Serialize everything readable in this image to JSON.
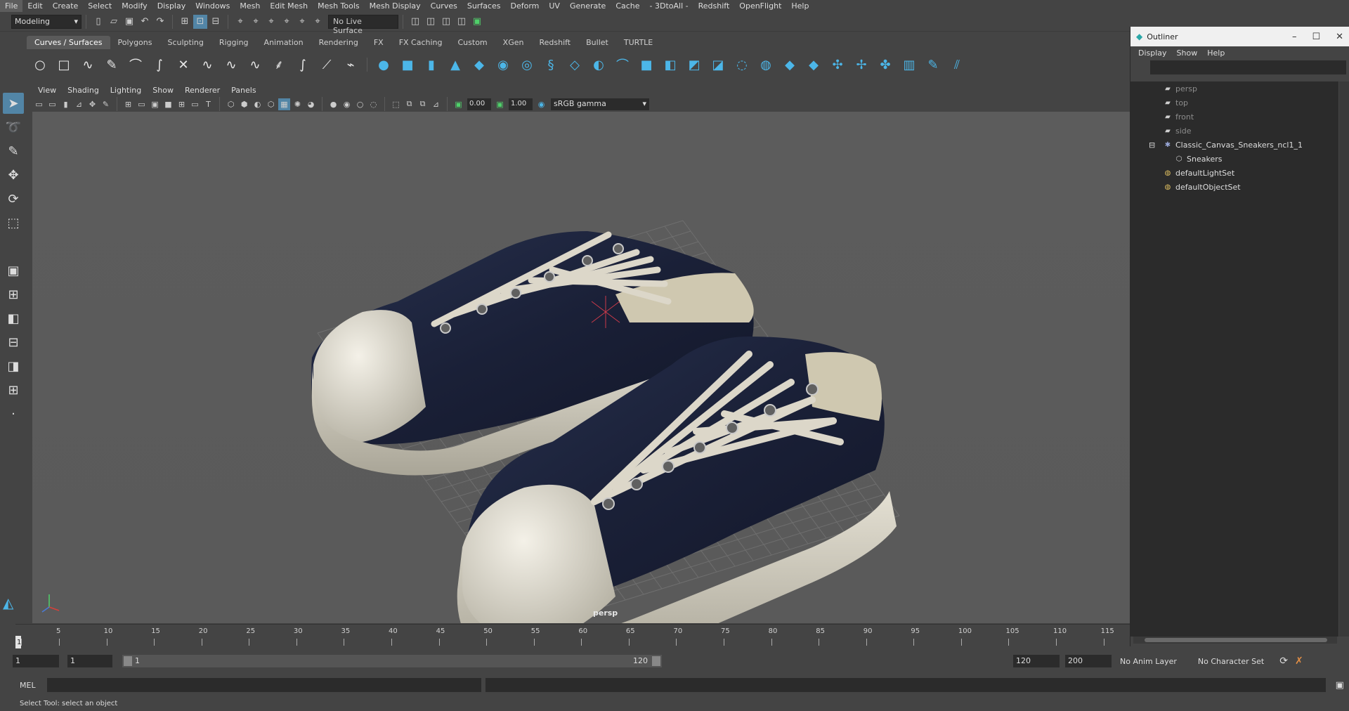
{
  "menu": [
    "File",
    "Edit",
    "Create",
    "Select",
    "Modify",
    "Display",
    "Windows",
    "Mesh",
    "Edit Mesh",
    "Mesh Tools",
    "Mesh Display",
    "Curves",
    "Surfaces",
    "Deform",
    "UV",
    "Generate",
    "Cache",
    "- 3DtoAll -",
    "Redshift",
    "OpenFlight",
    "Help"
  ],
  "status_line": {
    "mode": "Modeling",
    "live_surface": "No Live Surface"
  },
  "shelf_tabs": [
    "Curves / Surfaces",
    "Polygons",
    "Sculpting",
    "Rigging",
    "Animation",
    "Rendering",
    "FX",
    "FX Caching",
    "Custom",
    "XGen",
    "Redshift",
    "Bullet",
    "TURTLE"
  ],
  "shelf_active": "Curves / Surfaces",
  "panel_menu": [
    "View",
    "Shading",
    "Lighting",
    "Show",
    "Renderer",
    "Panels"
  ],
  "panel_toolbar": {
    "exposure": "0.00",
    "gamma": "1.00",
    "color_space": "sRGB gamma"
  },
  "viewport": {
    "camera_label": "persp"
  },
  "timeline": {
    "ticks": [
      "1",
      "5",
      "10",
      "15",
      "20",
      "25",
      "30",
      "35",
      "40",
      "45",
      "50",
      "55",
      "60",
      "65",
      "70",
      "75",
      "80",
      "85",
      "90",
      "95",
      "100",
      "105",
      "110",
      "115"
    ],
    "current_frame": "1"
  },
  "range": {
    "start": "1",
    "playback_start": "1",
    "slider_start": "1",
    "slider_end": "120",
    "playback_end": "120",
    "end": "200",
    "anim_layer": "No Anim Layer",
    "character_set": "No Character Set"
  },
  "command_line": {
    "lang": "MEL"
  },
  "help_line": "Select Tool: select an object",
  "outliner": {
    "title": "Outliner",
    "menu": [
      "Display",
      "Show",
      "Help"
    ],
    "items": [
      {
        "label": "persp",
        "icon": "camera-icon",
        "dim": true
      },
      {
        "label": "top",
        "icon": "camera-icon",
        "dim": true
      },
      {
        "label": "front",
        "icon": "camera-icon",
        "dim": true
      },
      {
        "label": "side",
        "icon": "camera-icon",
        "dim": true
      },
      {
        "label": "Classic_Canvas_Sneakers_ncl1_1",
        "icon": "group-icon",
        "dim": false
      },
      {
        "label": "Sneakers",
        "icon": "mesh-icon",
        "dim": false
      },
      {
        "label": "defaultLightSet",
        "icon": "set-icon",
        "dim": false
      },
      {
        "label": "defaultObjectSet",
        "icon": "set-icon",
        "dim": false
      }
    ]
  },
  "colors": {
    "accent": "#4cb6e8",
    "canvas": "#1b2238",
    "rubber": "#d4d0c2",
    "lace": "#e2ddd0"
  }
}
